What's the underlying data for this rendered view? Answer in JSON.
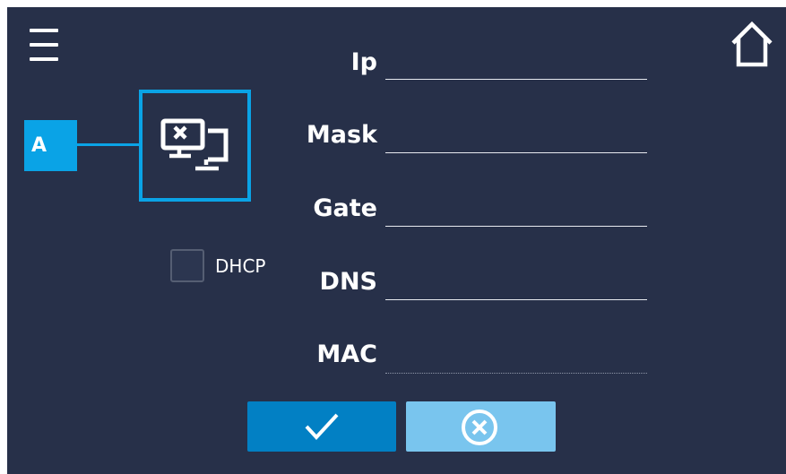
{
  "colors": {
    "background": "#273049",
    "accent": "#0aa3e6",
    "confirm_button": "#0280c4",
    "cancel_button": "#79c5ee",
    "text": "#ffffff"
  },
  "header": {
    "menu_icon": "hamburger-menu-icon",
    "home_icon": "home-icon"
  },
  "network": {
    "tag_label": "A",
    "device_icon": "network-computers-disconnected-icon"
  },
  "dhcp": {
    "label": "DHCP",
    "checked": false
  },
  "fields": {
    "ip_label": "Ip",
    "ip_value": "",
    "mask_label": "Mask",
    "mask_value": "",
    "gate_label": "Gate",
    "gate_value": "",
    "dns_label": "DNS",
    "dns_value": "",
    "mac_label": "MAC",
    "mac_value": ""
  },
  "actions": {
    "confirm_icon": "checkmark-icon",
    "cancel_icon": "cancel-circle-x-icon"
  }
}
